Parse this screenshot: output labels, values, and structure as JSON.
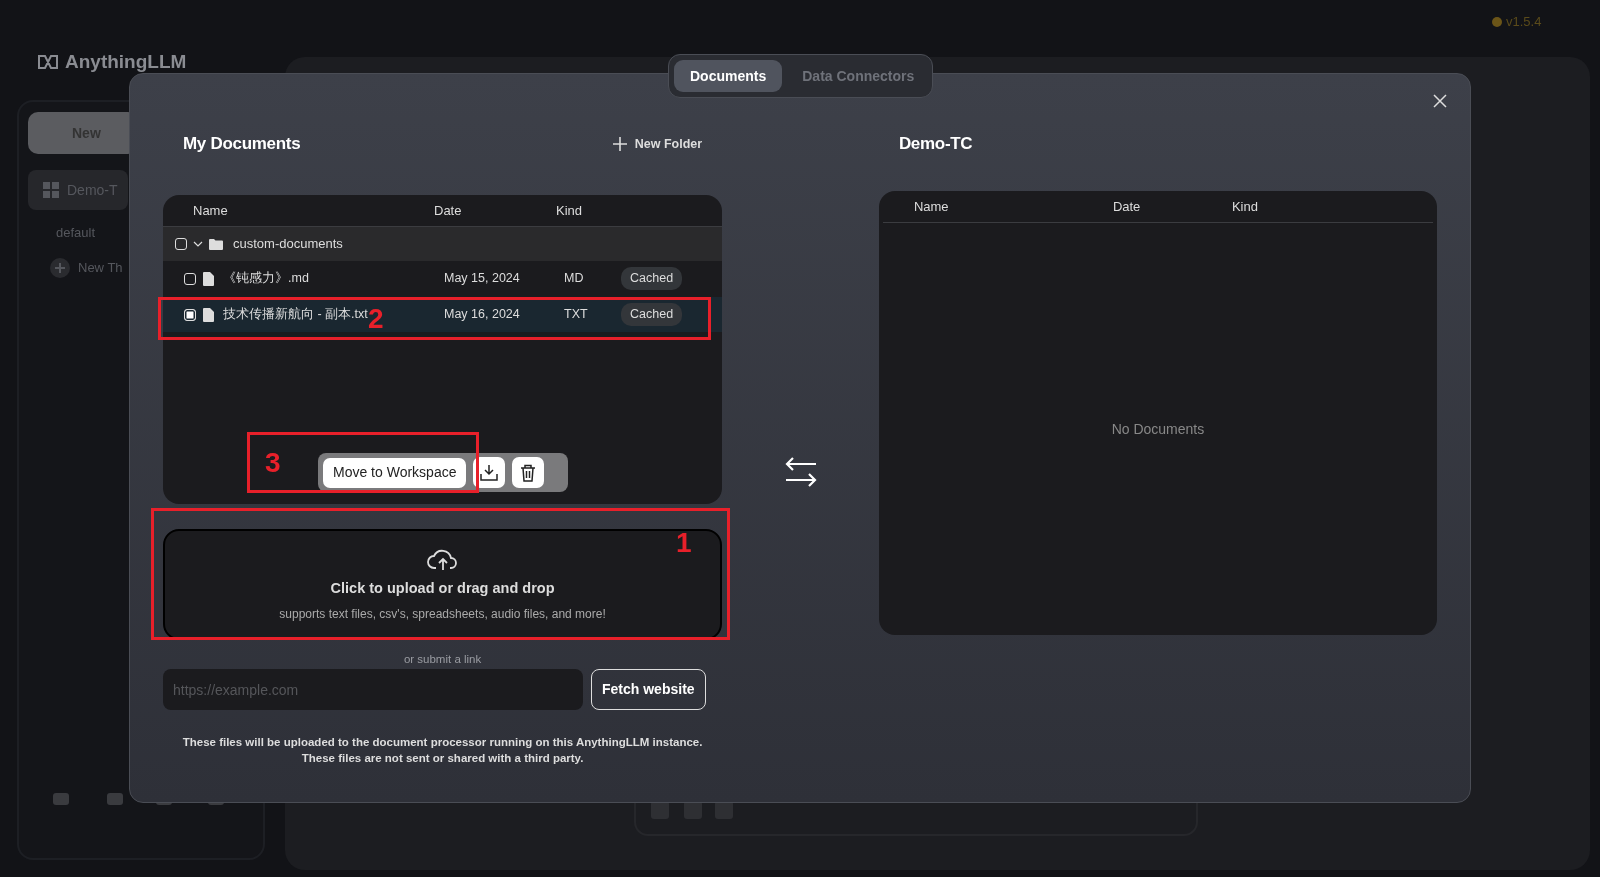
{
  "background": {
    "brand": "AnythingLLM",
    "new_button": "New",
    "workspace": "Demo-T",
    "thread": "default",
    "new_thread": "New Th",
    "version": "v1.5.4"
  },
  "tabs": [
    {
      "label": "Documents",
      "selected": true
    },
    {
      "label": "Data Connectors",
      "selected": false
    }
  ],
  "my_documents": {
    "title": "My Documents",
    "new_folder": "New Folder",
    "columns": [
      "Name",
      "Date",
      "Kind"
    ],
    "folder": {
      "name": "custom-documents",
      "checked": false,
      "expanded": true,
      "files": [
        {
          "name": "《钝感力》.md",
          "date": "May 15, 2024",
          "kind": "MD",
          "status": "Cached",
          "checked": false
        },
        {
          "name": "技术传播新航向 - 副本.txt",
          "date": "May 16, 2024",
          "kind": "TXT",
          "status": "Cached",
          "checked": true
        }
      ]
    }
  },
  "action_bar": {
    "move_button": "Move to Workspace"
  },
  "upload": {
    "title": "Click to upload or drag and drop",
    "subtitle": "supports text files, csv's, spreadsheets, audio files, and more!"
  },
  "link_label": "or submit a link",
  "url_field": {
    "placeholder": "https://example.com"
  },
  "fetch_button": "Fetch website",
  "notice": [
    "These files will be uploaded to the document processor running on this AnythingLLM instance.",
    "These files are not sent or shared with a third party."
  ],
  "workspace": {
    "title": "Demo-TC",
    "columns": [
      "Name",
      "Date",
      "Kind"
    ],
    "empty_text": "No Documents"
  },
  "annotations": [
    {
      "label": "1"
    },
    {
      "label": "2"
    },
    {
      "label": "3"
    }
  ]
}
